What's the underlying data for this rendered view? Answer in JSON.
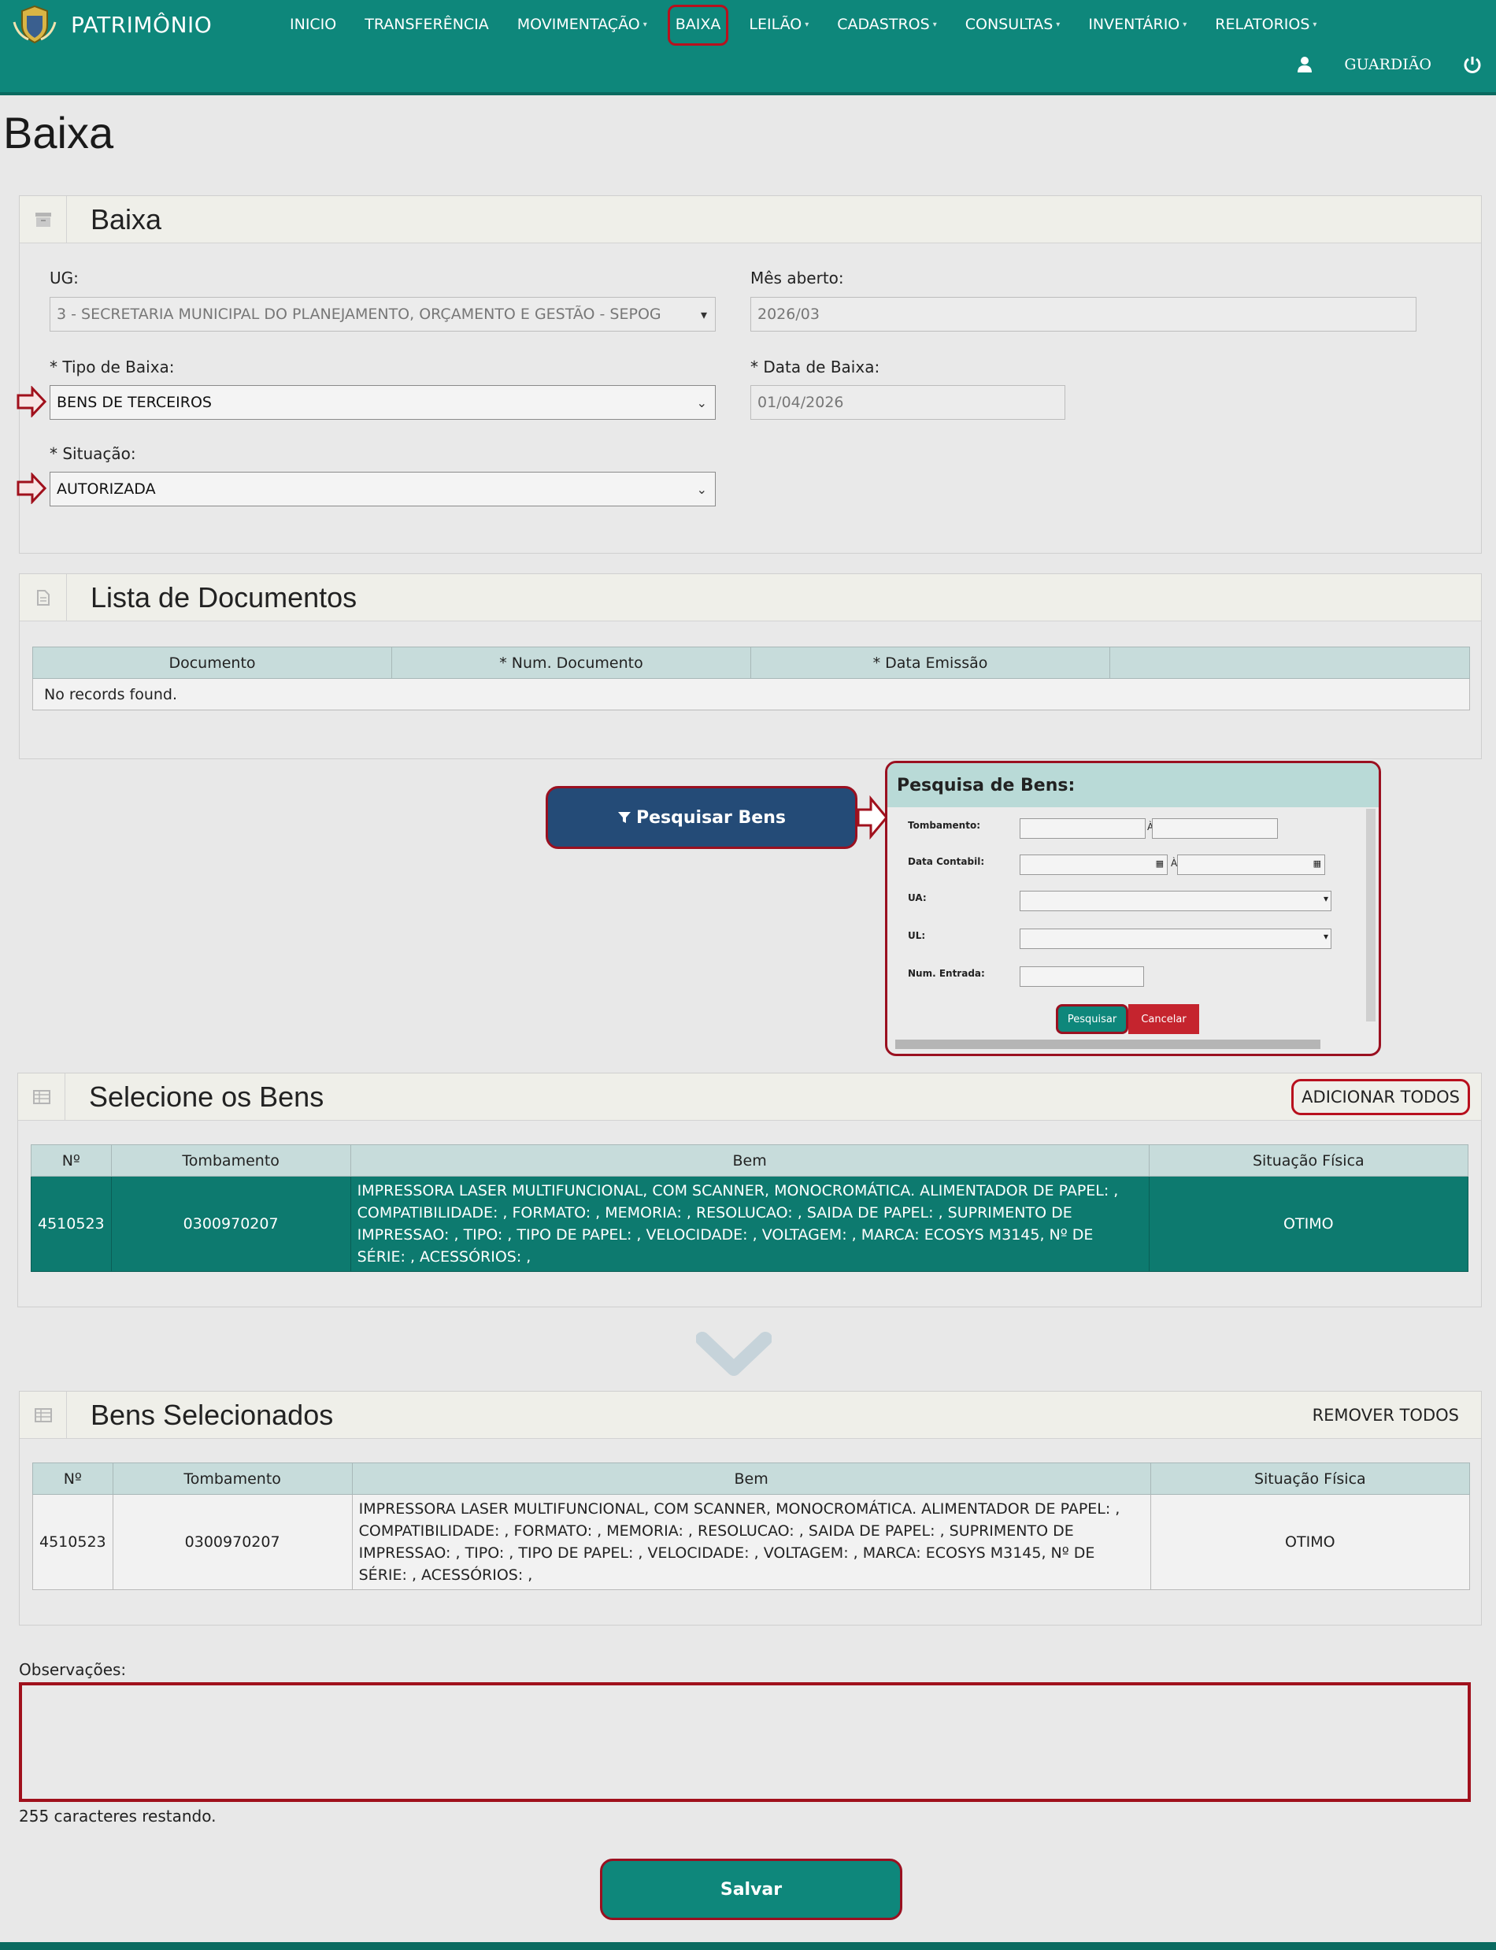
{
  "app": {
    "title": "PATRIMÔNIO",
    "user": "GUARDIÃO"
  },
  "nav": {
    "items": [
      {
        "label": "INICIO",
        "caret": ""
      },
      {
        "label": "TRANSFERÊNCIA",
        "caret": ""
      },
      {
        "label": "MOVIMENTAÇÃO",
        "caret": "▾"
      },
      {
        "label": "BAIXA",
        "caret": ""
      },
      {
        "label": "LEILÃO",
        "caret": "▾"
      },
      {
        "label": "CADASTROS",
        "caret": "▾"
      },
      {
        "label": "CONSULTAS",
        "caret": "▾"
      },
      {
        "label": "INVENTÁRIO",
        "caret": "▾"
      },
      {
        "label": "RELATORIOS",
        "caret": "▾"
      }
    ]
  },
  "page": {
    "title": "Baixa"
  },
  "baixa": {
    "title": "Baixa",
    "ug_label": "UG:",
    "ug_value": "3 - SECRETARIA MUNICIPAL DO PLANEJAMENTO, ORÇAMENTO E GESTÃO - SEPOG",
    "mes_label": "Mês aberto:",
    "mes_value": "2026/03",
    "tipo_label": "* Tipo de Baixa:",
    "tipo_value": "BENS DE TERCEIROS",
    "data_label": "* Data de Baixa:",
    "data_value": "01/04/2026",
    "situacao_label": "* Situação:",
    "situacao_value": "AUTORIZADA"
  },
  "documentos": {
    "title": "Lista de Documentos",
    "headers": [
      "Documento",
      "* Num. Documento",
      "* Data Emissão",
      ""
    ],
    "empty": "No records found."
  },
  "pesquisar_button": "Pesquisar Bens",
  "pesquisa": {
    "title": "Pesquisa de Bens:",
    "tombamento": "Tombamento:",
    "data_contabil": "Data Contabil:",
    "ua": "UA:",
    "ul": "UL:",
    "num_entrada": "Num. Entrada:",
    "range_sep": "À",
    "pesquisar": "Pesquisar",
    "cancelar": "Cancelar"
  },
  "selecione": {
    "title": "Selecione os Bens",
    "action": "ADICIONAR TODOS",
    "headers": [
      "Nº",
      "Tombamento",
      "Bem",
      "Situação Física"
    ],
    "rows": [
      {
        "n": "4510523",
        "tombamento": "0300970207",
        "bem": "IMPRESSORA LASER MULTIFUNCIONAL, COM SCANNER, MONOCROMÁTICA. ALIMENTADOR DE PAPEL: , COMPATIBILIDADE: , FORMATO: , MEMORIA: , RESOLUCAO: , SAIDA DE PAPEL: , SUPRIMENTO DE IMPRESSAO: , TIPO: , TIPO DE PAPEL: , VELOCIDADE: , VOLTAGEM: , MARCA: ECOSYS M3145, Nº DE SÉRIE: , ACESSÓRIOS: ,",
        "situacao": "OTIMO"
      }
    ]
  },
  "selecionados": {
    "title": "Bens Selecionados",
    "action": "REMOVER TODOS",
    "headers": [
      "Nº",
      "Tombamento",
      "Bem",
      "Situação Física"
    ],
    "rows": [
      {
        "n": "4510523",
        "tombamento": "0300970207",
        "bem": "IMPRESSORA LASER MULTIFUNCIONAL, COM SCANNER, MONOCROMÁTICA. ALIMENTADOR DE PAPEL: , COMPATIBILIDADE: , FORMATO: , MEMORIA: , RESOLUCAO: , SAIDA DE PAPEL: , SUPRIMENTO DE IMPRESSAO: , TIPO: , TIPO DE PAPEL: , VELOCIDADE: , VOLTAGEM: , MARCA: ECOSYS M3145, Nº DE SÉRIE: , ACESSÓRIOS: ,",
        "situacao": "OTIMO"
      }
    ]
  },
  "observacoes": {
    "label": "Observações:",
    "remaining": "255 caracteres restando."
  },
  "salvar": "Salvar",
  "colors": {
    "primary": "#0e877b",
    "highlight": "#b8101d",
    "search_button": "#244b77",
    "header_row": "#c7dcdb"
  }
}
